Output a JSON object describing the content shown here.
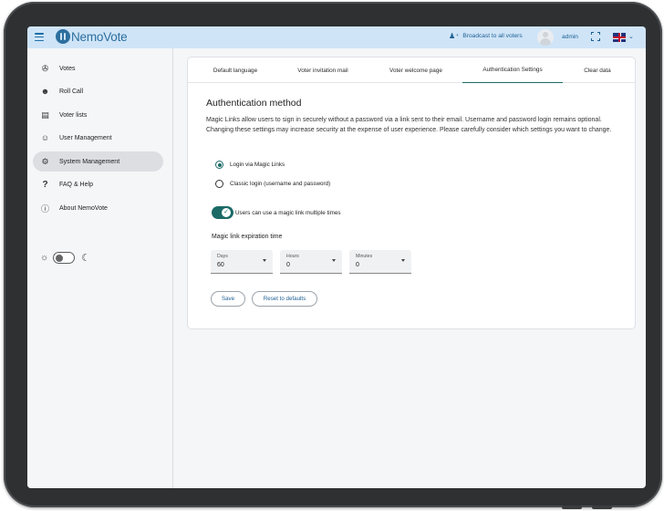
{
  "app": {
    "logo_text": "NemoVote"
  },
  "topbar": {
    "broadcast_label": "Broadcast to all voters",
    "username": "admin",
    "icons": [
      "menu-icon",
      "broadcast-icon",
      "avatar",
      "fullscreen-icon",
      "uk-flag-icon",
      "chevron-down-icon"
    ]
  },
  "sidebar": {
    "items": [
      {
        "label": "Votes",
        "icon": "votes-icon",
        "active": false
      },
      {
        "label": "Roll Call",
        "icon": "roll-call-icon",
        "active": false
      },
      {
        "label": "Voter lists",
        "icon": "list-icon",
        "active": false
      },
      {
        "label": "User Management",
        "icon": "users-icon",
        "active": false
      },
      {
        "label": "System Management",
        "icon": "gear-icon",
        "active": true
      },
      {
        "label": "FAQ & Help",
        "icon": "help-icon",
        "active": false
      },
      {
        "label": "About NemoVote",
        "icon": "info-icon",
        "active": false
      }
    ],
    "theme": {
      "light_icon": "sun-icon",
      "dark_icon": "moon-icon",
      "dark_mode": false
    }
  },
  "tabs": [
    {
      "label": "Default language",
      "active": false
    },
    {
      "label": "Voter invitation mail",
      "active": false
    },
    {
      "label": "Voter welcome page",
      "active": false
    },
    {
      "label": "Authentication Settings",
      "active": true
    },
    {
      "label": "Clear data",
      "active": false
    }
  ],
  "auth": {
    "title": "Authentication method",
    "description": "Magic Links allow users to sign in securely without a password via a link sent to their email. Username and password login remains optional. Changing these settings may increase security at the expense of user experience. Please carefully consider which settings you want to change.",
    "options": [
      {
        "label": "Login via Magic Links",
        "checked": true
      },
      {
        "label": "Classic login (username and password)",
        "checked": false
      }
    ],
    "multi_use_toggle": {
      "label": "Users can use a magic link multiple times",
      "on": true
    },
    "expiration": {
      "title": "Magic link expiration time",
      "fields": [
        {
          "label": "Days",
          "value": "60"
        },
        {
          "label": "Hours",
          "value": "0"
        },
        {
          "label": "Minutes",
          "value": "0"
        }
      ]
    },
    "save_label": "Save",
    "reset_label": "Reset to defaults"
  },
  "colors": {
    "accent": "#1b6a66",
    "topbar": "#cfe4f7",
    "brand": "#2c6f9e"
  }
}
